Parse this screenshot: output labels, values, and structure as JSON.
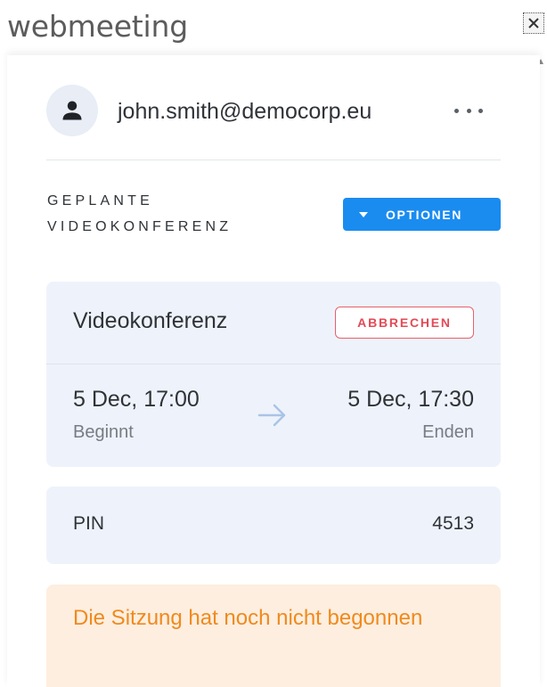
{
  "window": {
    "title": "webmeeting",
    "close_icon": "close-icon"
  },
  "user": {
    "email": "john.smith@democorp.eu",
    "avatar_icon": "person-icon",
    "more_icon": "more-horizontal-icon"
  },
  "section": {
    "title_line1": "GEPLANTE",
    "title_line2": "VIDEOKONFERENZ",
    "options_label": "OPTIONEN",
    "options_icon": "caret-down-icon"
  },
  "conference": {
    "title": "Videokonferenz",
    "cancel_label": "ABBRECHEN",
    "start_time": "5 Dec, 17:00",
    "start_label": "Beginnt",
    "end_time": "5 Dec, 17:30",
    "end_label": "Enden",
    "arrow_icon": "arrow-right-icon"
  },
  "pin": {
    "label": "PIN",
    "value": "4513"
  },
  "status": {
    "message": "Die Sitzung hat noch nicht begonnen"
  },
  "colors": {
    "accent": "#1a8cf0",
    "danger": "#e24b57",
    "warning_text": "#f08a1c",
    "warning_bg": "#fdeee0",
    "card_bg": "#eef3fb"
  }
}
